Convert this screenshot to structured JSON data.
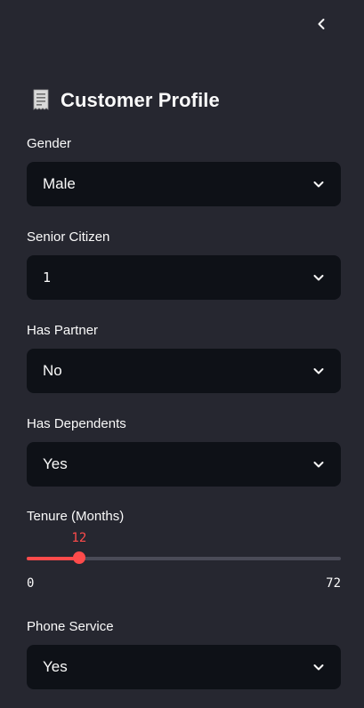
{
  "sidebar": {
    "title": "Customer Profile",
    "title_icon": "receipt-emoji-icon",
    "collapse_icon": "chevron-left-icon"
  },
  "fields": {
    "gender": {
      "label": "Gender",
      "value": "Male"
    },
    "senior_citizen": {
      "label": "Senior Citizen",
      "value": "1"
    },
    "partner": {
      "label": "Has Partner",
      "value": "No"
    },
    "dependents": {
      "label": "Has Dependents",
      "value": "Yes"
    },
    "phone_service": {
      "label": "Phone Service",
      "value": "Yes"
    }
  },
  "tenure": {
    "label": "Tenure (Months)",
    "value": 12,
    "min": 0,
    "max": 72
  },
  "colors": {
    "background": "#262730",
    "input_bg": "#0e1117",
    "accent": "#ff4b4b",
    "track": "#4a4b57",
    "text": "#fafafa"
  }
}
